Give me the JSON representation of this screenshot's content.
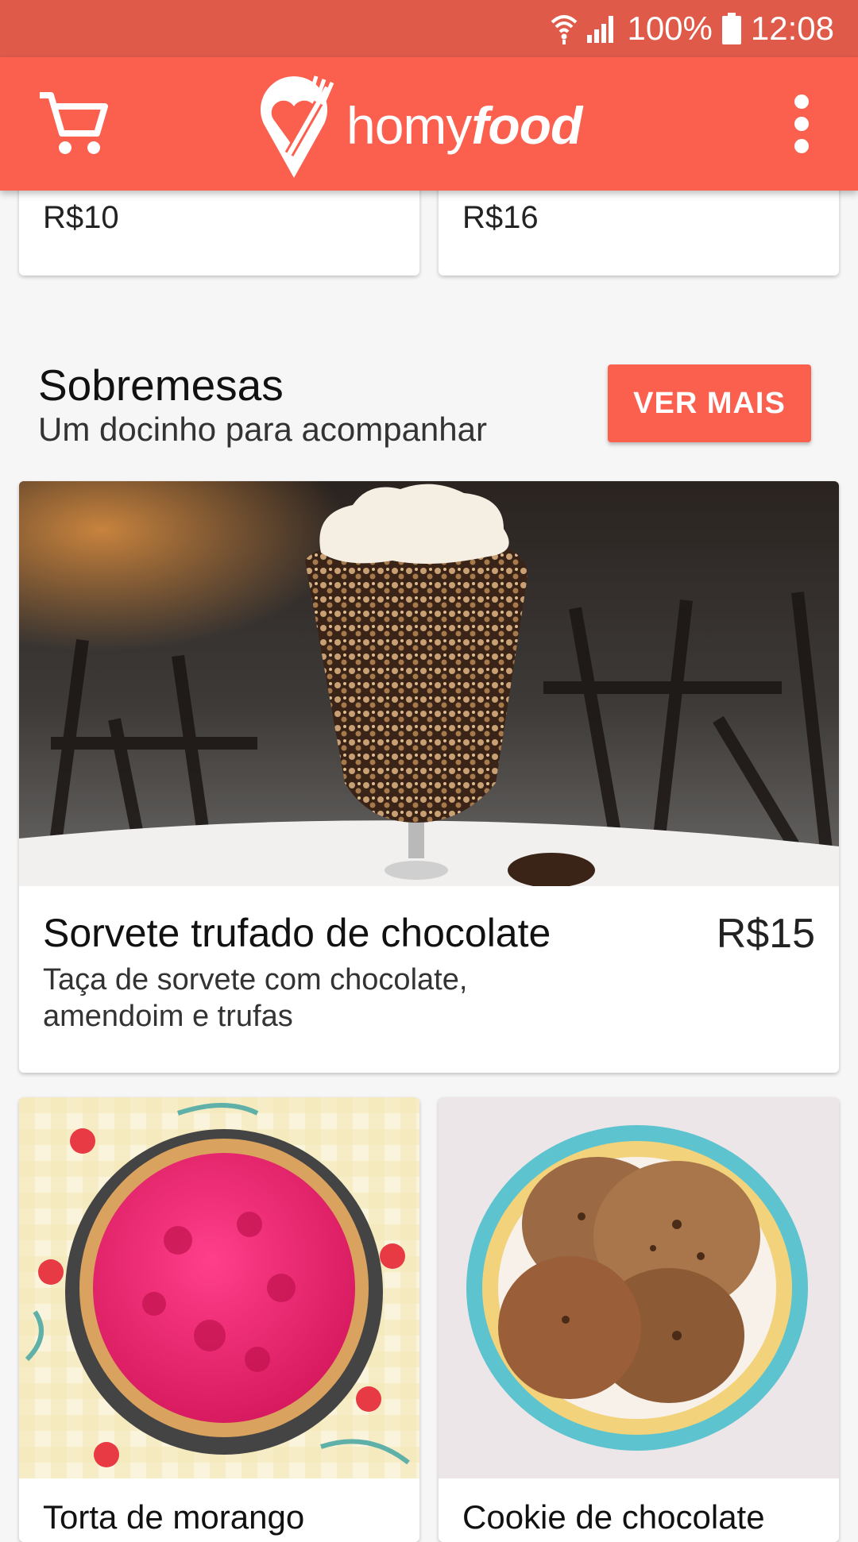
{
  "status_bar": {
    "battery": "100%",
    "time": "12:08"
  },
  "app": {
    "brand_light": "homy",
    "brand_bold": "food"
  },
  "top_cards": [
    {
      "price": "R$10"
    },
    {
      "price": "R$16"
    }
  ],
  "section": {
    "title": "Sobremesas",
    "subtitle": "Um docinho para acompanhar",
    "more_label": "VER MAIS"
  },
  "featured": {
    "name": "Sorvete trufado de chocolate",
    "price": "R$15",
    "description": "Taça de sorvete com chocolate, amendoim e trufas"
  },
  "grid_items": [
    {
      "name": "Torta de morango"
    },
    {
      "name": "Cookie de chocolate"
    }
  ],
  "colors": {
    "accent": "#fb5f4e",
    "status_bar": "#e05a4a"
  },
  "icons": [
    "wifi-icon",
    "signal-icon",
    "battery-icon",
    "cart-icon",
    "more-vert-icon",
    "logo-pin-icon"
  ]
}
